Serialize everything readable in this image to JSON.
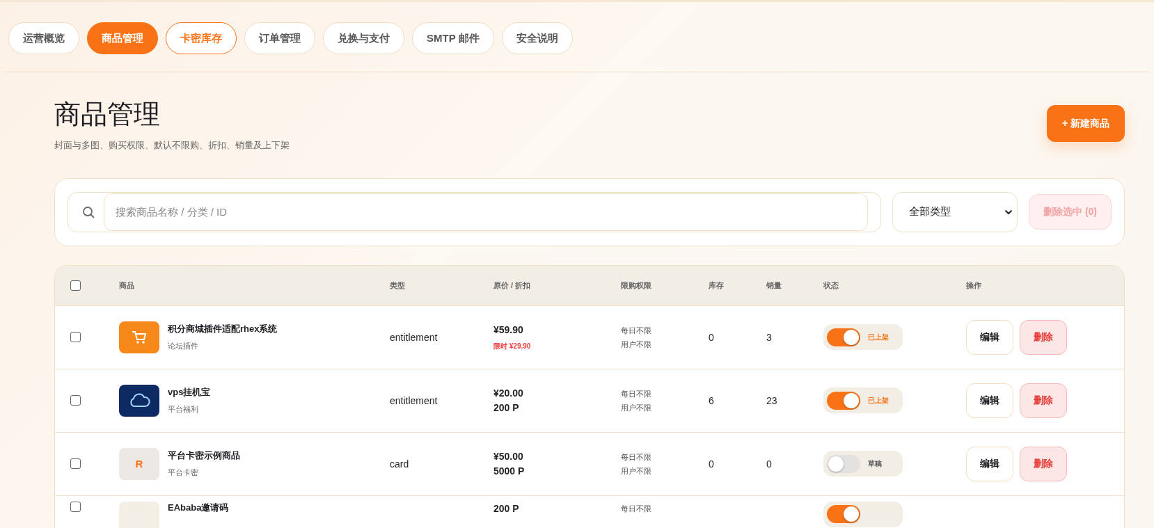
{
  "tabs": [
    {
      "label": "运营概览",
      "selected": false,
      "outlined": false
    },
    {
      "label": "商品管理",
      "selected": true,
      "outlined": false
    },
    {
      "label": "卡密库存",
      "selected": false,
      "outlined": true
    },
    {
      "label": "订单管理",
      "selected": false,
      "outlined": false
    },
    {
      "label": "兑换与支付",
      "selected": false,
      "outlined": false
    },
    {
      "label": "SMTP 邮件",
      "selected": false,
      "outlined": false
    },
    {
      "label": "安全说明",
      "selected": false,
      "outlined": false
    }
  ],
  "page": {
    "title": "商品管理",
    "subtitle": "封面与多图、购买权限、默认不限购、折扣、销量及上下架",
    "new_button": "+ 新建商品"
  },
  "filters": {
    "search_placeholder": "搜索商品名称 / 分类 / ID",
    "type_select": "全部类型",
    "delete_selected": {
      "label": "删除选中 (0)",
      "disabled": true
    }
  },
  "table": {
    "select_all": {
      "checked": false
    },
    "columns": [
      "商品",
      "类型",
      "原价 / 折扣",
      "限购权限",
      "库存",
      "销量",
      "状态",
      "操作"
    ],
    "rows": [
      {
        "selected": false,
        "thumb": {
          "kind": "cart"
        },
        "name": "积分商城插件适配rhex系统",
        "category": "论坛插件",
        "type": "entitlement",
        "prices": [
          {
            "kind": "base",
            "text": "¥59.90"
          },
          {
            "kind": "discount",
            "text": "限时 ¥29.90"
          }
        ],
        "limits": [
          "每日不限",
          "用户不限"
        ],
        "stock": "0",
        "sales": "3",
        "status": {
          "on": true,
          "label": "已上架"
        },
        "actions": [
          "编辑",
          "删除"
        ]
      },
      {
        "selected": false,
        "thumb": {
          "kind": "cloud"
        },
        "name": "vps挂机宝",
        "category": "平台福利",
        "type": "entitlement",
        "prices": [
          {
            "kind": "base",
            "text": "¥20.00"
          },
          {
            "kind": "points",
            "text": "200 P"
          }
        ],
        "limits": [
          "每日不限",
          "用户不限"
        ],
        "stock": "6",
        "sales": "23",
        "status": {
          "on": true,
          "label": "已上架"
        },
        "actions": [
          "编辑",
          "删除"
        ]
      },
      {
        "selected": false,
        "thumb": {
          "kind": "letter",
          "text": "R"
        },
        "name": "平台卡密示例商品",
        "category": "平台卡密",
        "type": "card",
        "prices": [
          {
            "kind": "base",
            "text": "¥50.00"
          },
          {
            "kind": "points",
            "text": "5000 P"
          }
        ],
        "limits": [
          "每日不限",
          "用户不限"
        ],
        "stock": "0",
        "sales": "0",
        "status": {
          "on": false,
          "label": "草稿"
        },
        "actions": [
          "编辑",
          "删除"
        ]
      },
      {
        "selected": false,
        "thumb": {
          "kind": "photo"
        },
        "name": "EAbaba邀请码",
        "prices": [
          {
            "kind": "points",
            "text": "200 P"
          }
        ],
        "limits": [
          "每日不限"
        ],
        "status": {
          "on": true
        },
        "actions": []
      }
    ]
  }
}
